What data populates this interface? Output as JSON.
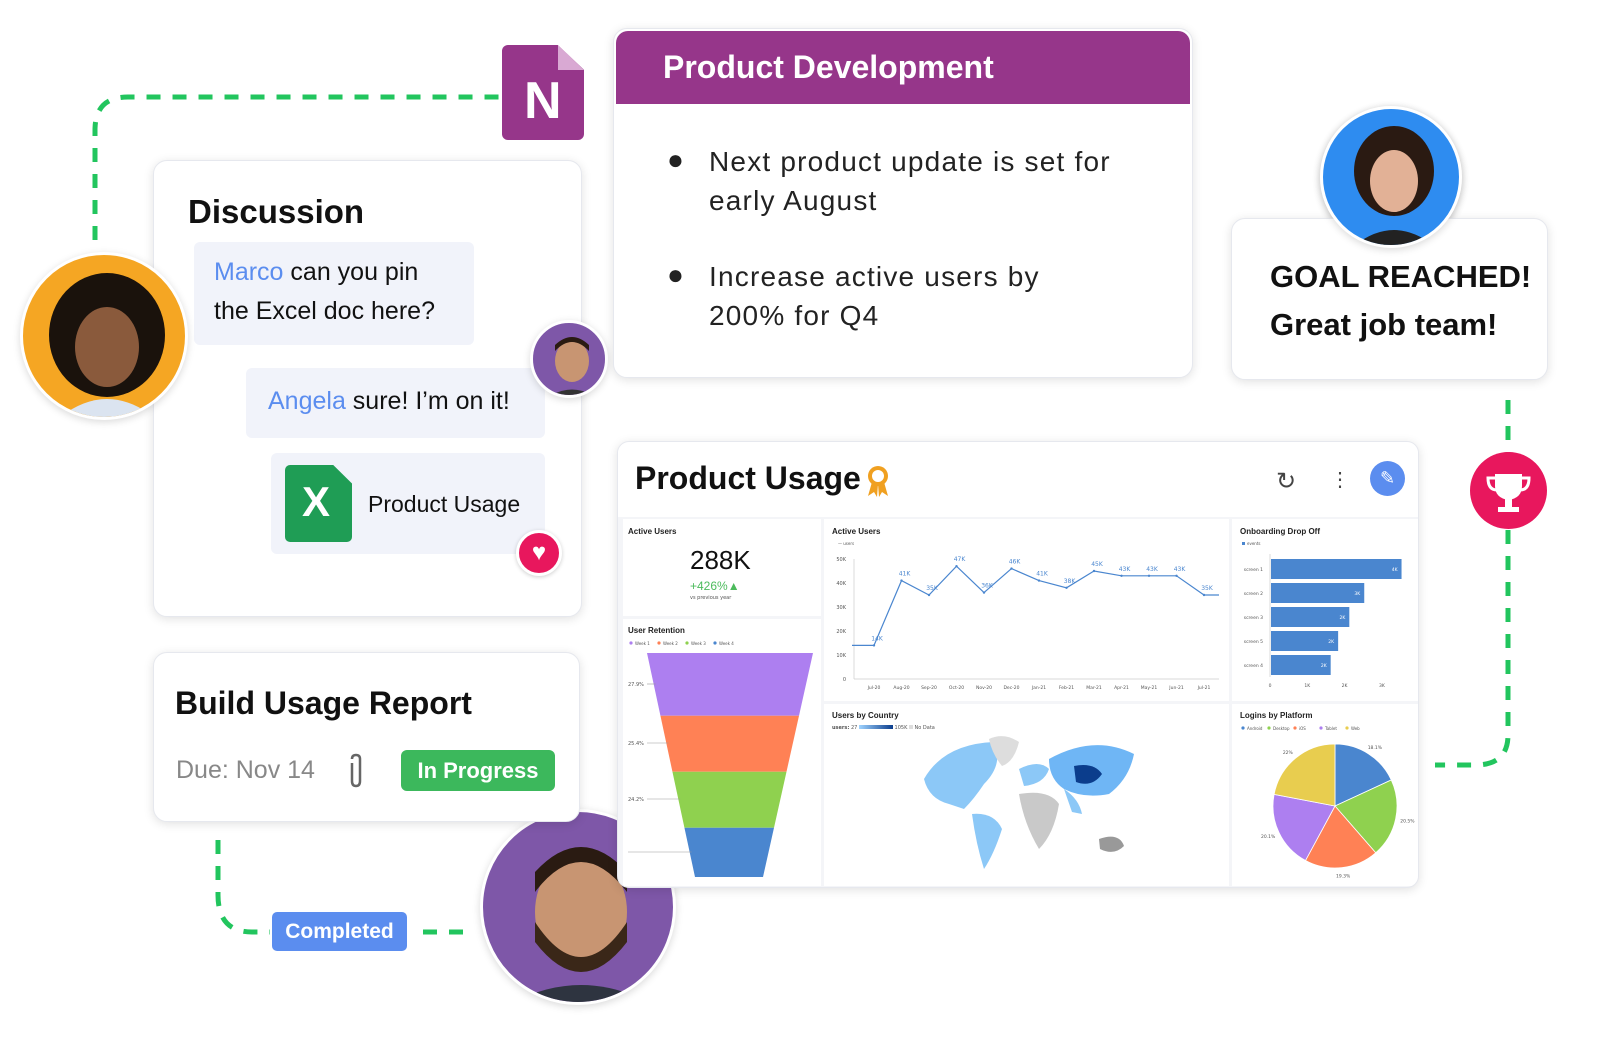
{
  "colors": {
    "accent_green": "#22c55e",
    "onenote_purple": "#96368a",
    "link_blue": "#5b8def",
    "excel_green": "#1f9d55",
    "heart": "#e8175d",
    "trophy": "#e8175d",
    "progress": "#3cb85c",
    "completed": "#5b8def",
    "chart_blue": "#4a86cf"
  },
  "onenote": {
    "icon": "onenote-icon",
    "letter": "N"
  },
  "discussion": {
    "title": "Discussion",
    "messages": [
      {
        "mention": "Marco",
        "text_line1": " can you pin",
        "text_line2": "the Excel doc here?"
      },
      {
        "mention": "Angela",
        "text": " sure! I’m on it!"
      }
    ],
    "attachment": {
      "icon": "excel-icon",
      "letter": "X",
      "name": "Product Usage"
    },
    "reaction": "heart-icon"
  },
  "product_development": {
    "title": "Product Development",
    "bullets": [
      {
        "line1": "Next product update is set for",
        "line2": "early August"
      },
      {
        "line1": "Increase active users by",
        "line2": "200% for Q4"
      }
    ]
  },
  "goal": {
    "line1": "GOAL REACHED!",
    "line2": "Great job team!",
    "icon": "trophy-icon"
  },
  "task": {
    "title": "Build Usage Report",
    "due": "Due: Nov 14",
    "attachment_icon": "paperclip-icon",
    "status": "In Progress",
    "completed_badge": "Completed"
  },
  "dashboard": {
    "title": "Product Usage",
    "title_icon": "award-ribbon-icon",
    "actions": [
      "refresh-icon",
      "more-vertical-icon",
      "edit-pencil-icon"
    ],
    "kpi": {
      "title": "Active Users",
      "value": "288K",
      "change": "+426%",
      "change_icon": "triangle-up-icon",
      "caption": "vs previous year"
    }
  },
  "chart_data": [
    {
      "type": "line",
      "title": "Active Users",
      "legend": [
        "users"
      ],
      "categories": [
        "Jul-20",
        "Aug-20",
        "Sep-20",
        "Oct-20",
        "Nov-20",
        "Dec-20",
        "Jan-21",
        "Feb-21",
        "Mar-21",
        "Apr-21",
        "May-21",
        "Jun-21",
        "Jul-21"
      ],
      "values": [
        14,
        41,
        35,
        47,
        36,
        46,
        41,
        38,
        45,
        43,
        43,
        43,
        35
      ],
      "labels": [
        "14K",
        "41K",
        "35K",
        "47K",
        "36K",
        "46K",
        "41K",
        "38K",
        "45K",
        "43K",
        "43K",
        "43K",
        "35K"
      ],
      "yticks": [
        "0",
        "10K",
        "20K",
        "30K",
        "40K",
        "50K"
      ],
      "ylim": [
        0,
        50
      ]
    },
    {
      "type": "bar",
      "orientation": "horizontal",
      "title": "Onboarding Drop Off",
      "legend": [
        "events"
      ],
      "categories": [
        "screen 1",
        "screen 2",
        "screen 3",
        "screen 5",
        "screen 4"
      ],
      "values": [
        3.5,
        2.5,
        2.1,
        1.8,
        1.6
      ],
      "labels": [
        "4K",
        "3K",
        "2K",
        "2K",
        "2K"
      ],
      "xticks": [
        "0",
        "1K",
        "2K",
        "3K"
      ],
      "xlim": [
        0,
        3.7
      ]
    },
    {
      "type": "funnel",
      "title": "User Retention",
      "legend": [
        "Week 1",
        "Week 2",
        "Week 3",
        "Week 4"
      ],
      "labels": [
        "27.9%",
        "25.4%",
        "24.2%"
      ],
      "colors": [
        "#ad7ff0",
        "#ff8155",
        "#8fd14f",
        "#4a86cf"
      ]
    },
    {
      "type": "pie",
      "title": "Logins by Platform",
      "categories": [
        "Android",
        "Desktop",
        "iOS",
        "Tablet",
        "Web"
      ],
      "values": [
        18.1,
        20.5,
        19.3,
        20.1,
        22
      ],
      "labels": [
        "18.1%",
        "20.5%",
        "19.3%",
        "20.1%",
        "22%"
      ],
      "colors": [
        "#4a86cf",
        "#8fd14f",
        "#ff8155",
        "#ad7ff0",
        "#e8cd4f"
      ]
    },
    {
      "type": "map",
      "title": "Users by Country",
      "legend_label": "users:",
      "min": "27",
      "max": "105K",
      "no_data": "No Data"
    }
  ]
}
